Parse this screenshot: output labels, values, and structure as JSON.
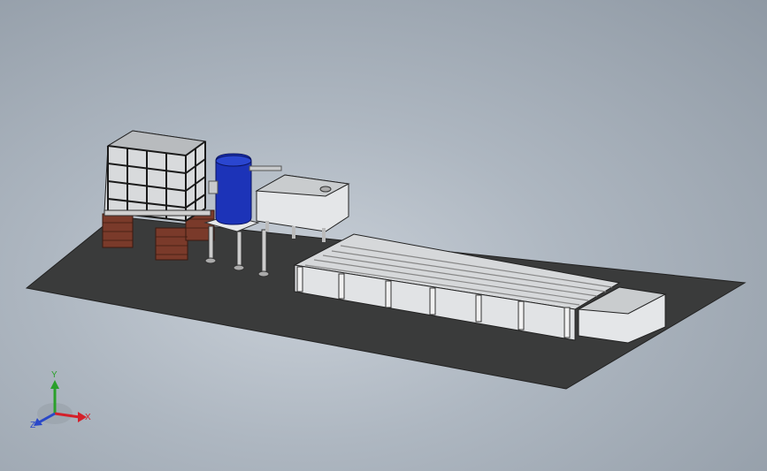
{
  "viewport": {
    "background_top": "#8f99a4",
    "background_center": "#c9d0d8",
    "model_name": "",
    "components": [
      "ground-plate",
      "ibc-tote-tank",
      "brick-supports",
      "blue-barrel",
      "barrel-stand",
      "settling-tank",
      "grow-bed-long",
      "sump-tank"
    ]
  },
  "triad": {
    "x_label": "X",
    "y_label": "Y",
    "z_label": "Z",
    "x_color": "#d4202a",
    "y_color": "#2aa02a",
    "z_color": "#2a48c8"
  },
  "colors": {
    "plate": "#3a3b3b",
    "barrel": "#1c33b8",
    "tank": "#e4e6e8",
    "brick": "#7a3a2a",
    "cage": "#202020"
  }
}
